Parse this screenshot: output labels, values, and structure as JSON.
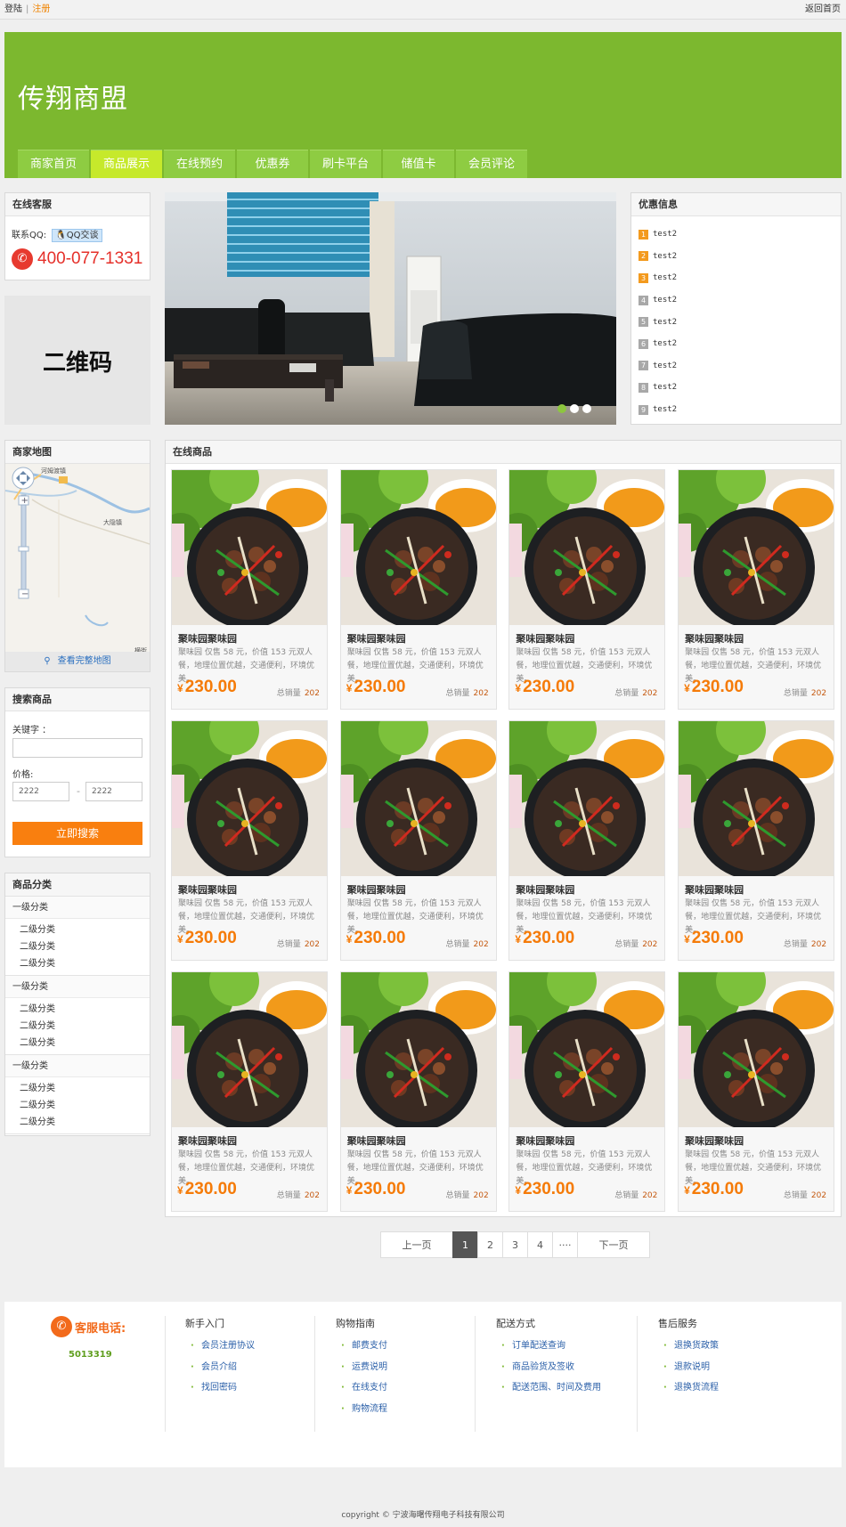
{
  "topbar": {
    "login": "登陆",
    "sep": "|",
    "register": "注册",
    "home": "返回首页"
  },
  "header": {
    "title": "传翔商盟"
  },
  "nav": [
    "商家首页",
    "商品展示",
    "在线预约",
    "优惠券",
    "刷卡平台",
    "储值卡",
    "会员评论"
  ],
  "nav_active": 1,
  "kefu": {
    "title": "在线客服",
    "qq_label": "联系QQ:",
    "qq_button": "QQ交谈",
    "phone": "400-077-1331"
  },
  "qr": {
    "text": "二维码"
  },
  "map": {
    "title": "商家地图",
    "link": "查看完整地图",
    "labels": [
      "河姆渡镇",
      "大隐镇",
      "横街"
    ]
  },
  "search": {
    "title": "搜索商品",
    "keyword_label": "关键字 ：",
    "keyword_value": "",
    "price_label": "价格:",
    "price_min": "2222",
    "price_sep": "-",
    "price_max": "2222",
    "button": "立即搜索"
  },
  "categories": {
    "title": "商品分类",
    "groups": [
      {
        "name": "一级分类",
        "items": [
          "二级分类",
          "二级分类",
          "二级分类"
        ]
      },
      {
        "name": "一级分类",
        "items": [
          "二级分类",
          "二级分类",
          "二级分类"
        ]
      },
      {
        "name": "一级分类",
        "items": [
          "二级分类",
          "二级分类",
          "二级分类"
        ]
      }
    ]
  },
  "promo": {
    "title": "优惠信息",
    "items": [
      {
        "n": "1",
        "text": "test2",
        "color": "#f39a1e"
      },
      {
        "n": "2",
        "text": "test2",
        "color": "#f39a1e"
      },
      {
        "n": "3",
        "text": "test2",
        "color": "#f39a1e"
      },
      {
        "n": "4",
        "text": "test2",
        "color": "#a8a8a8"
      },
      {
        "n": "5",
        "text": "test2",
        "color": "#a8a8a8"
      },
      {
        "n": "6",
        "text": "test2",
        "color": "#a8a8a8"
      },
      {
        "n": "7",
        "text": "test2",
        "color": "#a8a8a8"
      },
      {
        "n": "8",
        "text": "test2",
        "color": "#a8a8a8"
      },
      {
        "n": "9",
        "text": "test2",
        "color": "#a8a8a8"
      }
    ]
  },
  "products_title": "在线商品",
  "products": [
    {
      "name": "聚味园聚味园",
      "desc": "聚味园 仅售 58 元，价值 153 元双人餐，地理位置优越，交通便利，环境优美。",
      "currency": "¥",
      "price": "230.00",
      "sales_label": "总销量",
      "sales": "202"
    },
    {
      "name": "聚味园聚味园",
      "desc": "聚味园 仅售 58 元，价值 153 元双人餐，地理位置优越，交通便利，环境优美。",
      "currency": "¥",
      "price": "230.00",
      "sales_label": "总销量",
      "sales": "202"
    },
    {
      "name": "聚味园聚味园",
      "desc": "聚味园 仅售 58 元，价值 153 元双人餐，地理位置优越，交通便利，环境优美。",
      "currency": "¥",
      "price": "230.00",
      "sales_label": "总销量",
      "sales": "202"
    },
    {
      "name": "聚味园聚味园",
      "desc": "聚味园 仅售 58 元，价值 153 元双人餐，地理位置优越，交通便利，环境优美。",
      "currency": "¥",
      "price": "230.00",
      "sales_label": "总销量",
      "sales": "202"
    },
    {
      "name": "聚味园聚味园",
      "desc": "聚味园 仅售 58 元，价值 153 元双人餐，地理位置优越，交通便利，环境优美。",
      "currency": "¥",
      "price": "230.00",
      "sales_label": "总销量",
      "sales": "202"
    },
    {
      "name": "聚味园聚味园",
      "desc": "聚味园 仅售 58 元，价值 153 元双人餐，地理位置优越，交通便利，环境优美。",
      "currency": "¥",
      "price": "230.00",
      "sales_label": "总销量",
      "sales": "202"
    },
    {
      "name": "聚味园聚味园",
      "desc": "聚味园 仅售 58 元，价值 153 元双人餐，地理位置优越，交通便利，环境优美。",
      "currency": "¥",
      "price": "230.00",
      "sales_label": "总销量",
      "sales": "202"
    },
    {
      "name": "聚味园聚味园",
      "desc": "聚味园 仅售 58 元，价值 153 元双人餐，地理位置优越，交通便利，环境优美。",
      "currency": "¥",
      "price": "230.00",
      "sales_label": "总销量",
      "sales": "202"
    },
    {
      "name": "聚味园聚味园",
      "desc": "聚味园 仅售 58 元，价值 153 元双人餐，地理位置优越，交通便利，环境优美。",
      "currency": "¥",
      "price": "230.00",
      "sales_label": "总销量",
      "sales": "202"
    },
    {
      "name": "聚味园聚味园",
      "desc": "聚味园 仅售 58 元，价值 153 元双人餐，地理位置优越，交通便利，环境优美。",
      "currency": "¥",
      "price": "230.00",
      "sales_label": "总销量",
      "sales": "202"
    },
    {
      "name": "聚味园聚味园",
      "desc": "聚味园 仅售 58 元，价值 153 元双人餐，地理位置优越，交通便利，环境优美。",
      "currency": "¥",
      "price": "230.00",
      "sales_label": "总销量",
      "sales": "202"
    },
    {
      "name": "聚味园聚味园",
      "desc": "聚味园 仅售 58 元，价值 153 元双人餐，地理位置优越，交通便利，环境优美。",
      "currency": "¥",
      "price": "230.00",
      "sales_label": "总销量",
      "sales": "202"
    }
  ],
  "pager": {
    "prev": "上一页",
    "pages": [
      "1",
      "2",
      "3",
      "4"
    ],
    "current": "1",
    "ellipsis": "····",
    "next": "下一页"
  },
  "footer": {
    "hotline_label": "客服电话:",
    "hotline": "5013319",
    "columns": [
      {
        "title": "新手入门",
        "links": [
          "会员注册协议",
          "会员介绍",
          "找回密码"
        ]
      },
      {
        "title": "购物指南",
        "links": [
          "邮费支付",
          "运费说明",
          "在线支付",
          "购物流程"
        ]
      },
      {
        "title": "配送方式",
        "links": [
          "订单配送查询",
          "商品验货及签收",
          "配送范围、时间及费用"
        ]
      },
      {
        "title": "售后服务",
        "links": [
          "退换货政策",
          "退款说明",
          "退换货流程"
        ]
      }
    ],
    "copyright": "copyright © 宁波海曙传翔电子科技有限公司"
  },
  "colors": {
    "brand_green": "#7cb82f",
    "nav_active": "#c6e92b",
    "price_orange": "#f57b08",
    "button_orange": "#f97f0f",
    "phone_red": "#e5302a"
  }
}
